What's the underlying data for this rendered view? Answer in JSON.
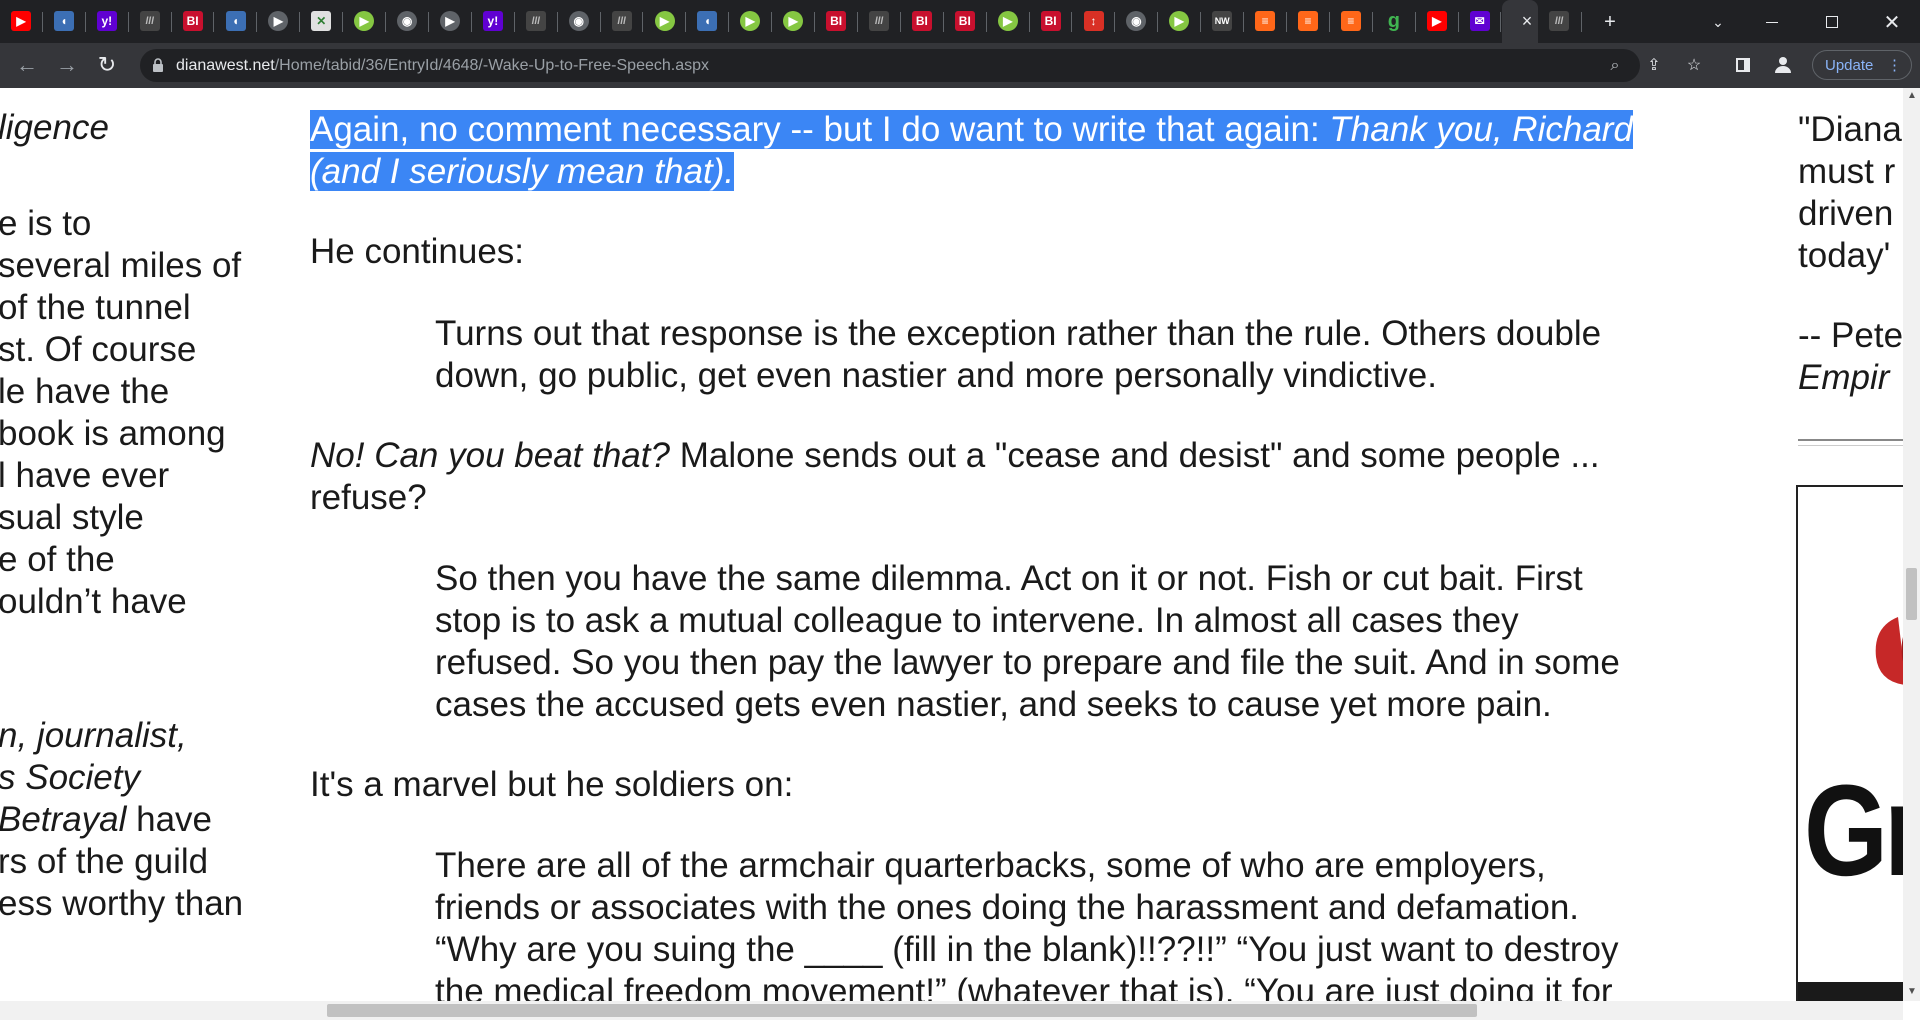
{
  "browser": {
    "tabs": [
      {
        "icon": "youtube-icon",
        "color": "#ff0000",
        "glyph": "▶"
      },
      {
        "icon": "shield-icon",
        "color": "#3c6fb4",
        "glyph": "◖"
      },
      {
        "icon": "yahoo-icon",
        "color": "#6001d2",
        "glyph": "y!"
      },
      {
        "icon": "ltl-icon",
        "color": "#444444",
        "glyph": "lll"
      },
      {
        "icon": "bi-icon",
        "color": "#c8102e",
        "glyph": "BI"
      },
      {
        "icon": "shield-icon",
        "color": "#3c6fb4",
        "glyph": "◖"
      },
      {
        "icon": "flag-icon",
        "color": "#5f6368",
        "glyph": "▶"
      },
      {
        "icon": "doc-icon",
        "color": "#e0e0e0",
        "glyph": "✕"
      },
      {
        "icon": "rumble-icon",
        "color": "#85c742",
        "glyph": "▶"
      },
      {
        "icon": "globe-icon",
        "color": "#5f6368",
        "glyph": "◉"
      },
      {
        "icon": "flag-icon",
        "color": "#5f6368",
        "glyph": "▶"
      },
      {
        "icon": "yahoo-icon",
        "color": "#6001d2",
        "glyph": "y!"
      },
      {
        "icon": "ltl-icon",
        "color": "#444444",
        "glyph": "lll"
      },
      {
        "icon": "globe-icon",
        "color": "#5f6368",
        "glyph": "◉"
      },
      {
        "icon": "ltl-icon",
        "color": "#444444",
        "glyph": "lll"
      },
      {
        "icon": "rumble-icon",
        "color": "#85c742",
        "glyph": "▶"
      },
      {
        "icon": "shield-icon",
        "color": "#3c6fb4",
        "glyph": "◖"
      },
      {
        "icon": "rumble-icon",
        "color": "#85c742",
        "glyph": "▶"
      },
      {
        "icon": "rumble-icon",
        "color": "#85c742",
        "glyph": "▶"
      },
      {
        "icon": "bi-icon",
        "color": "#c8102e",
        "glyph": "BI"
      },
      {
        "icon": "ltl-icon",
        "color": "#444444",
        "glyph": "lll"
      },
      {
        "icon": "bi-icon",
        "color": "#c8102e",
        "glyph": "BI"
      },
      {
        "icon": "bi-icon",
        "color": "#c8102e",
        "glyph": "BI"
      },
      {
        "icon": "rumble-icon",
        "color": "#85c742",
        "glyph": "▶"
      },
      {
        "icon": "bi-icon",
        "color": "#c8102e",
        "glyph": "BI"
      },
      {
        "icon": "pin-icon",
        "color": "#d93025",
        "glyph": "↕"
      },
      {
        "icon": "globe-icon",
        "color": "#5f6368",
        "glyph": "◉"
      },
      {
        "icon": "rumble-icon",
        "color": "#85c742",
        "glyph": "▶"
      },
      {
        "icon": "news-icon",
        "color": "#444444",
        "glyph": "NW"
      },
      {
        "icon": "bookmark-icon",
        "color": "#ff6719",
        "glyph": "≡"
      },
      {
        "icon": "bookmark-icon",
        "color": "#ff6719",
        "glyph": "≡"
      },
      {
        "icon": "bookmark-icon",
        "color": "#ff6719",
        "glyph": "≡"
      },
      {
        "icon": "g-icon",
        "color": "#40b551",
        "glyph": "g"
      },
      {
        "icon": "youtube-icon",
        "color": "#ff0000",
        "glyph": "▶"
      },
      {
        "icon": "mail-icon",
        "color": "#6001d2",
        "glyph": "✉"
      }
    ],
    "active_tab_close": "×",
    "last_tab_icon": "ltl-icon",
    "new_tab": "+",
    "address": {
      "host": "dianawest.net",
      "path": "/Home/tabid/36/EntryId/4648/-Wake-Up-to-Free-Speech.aspx"
    },
    "update_label": "Update"
  },
  "article": {
    "para1_line1_plain": "Again, no comment necessary -- but I do want to write that again: ",
    "para1_line1_italic": "Thank you, Richard",
    "para1_line2_italic": "(and I seriously mean that).",
    "para2": "He continues:",
    "quote1_line1": "Turns out that response is the exception rather than the rule. Others double",
    "quote1_line2": "down, go public, get even nastier and more personally vindictive.",
    "para3_italic": "No! Can you beat that?",
    "para3_plain": " Malone sends out a \"cease and desist\" and some people ...",
    "para3_line2": "refuse?",
    "quote2_line1": "So then you have the same dilemma. Act on it or not. Fish or cut bait. First",
    "quote2_line2": "stop is to ask a mutual colleague to intervene. In almost all cases they",
    "quote2_line3": "refused. So you then pay the lawyer to prepare and file the suit. And in some",
    "quote2_line4": "cases the accused gets even nastier, and seeks to cause yet more pain.",
    "para4": "It's a marvel but he soldiers on:",
    "quote3_line1": "There are all of the armchair quarterbacks, some of who are employers,",
    "quote3_line2": "friends or associates with the ones doing the harassment and defamation.",
    "quote3_line3": "“Why are you suing the ____ (fill in the blank)!!??!!” “You just want to destroy",
    "quote3_line4": "the medical freedom movement!” (whatever that is). “You are just doing it for"
  },
  "left_column": {
    "lines": [
      {
        "text": "ligence",
        "italic": true
      },
      {
        "text": "e is to",
        "italic": false
      },
      {
        "text": "several miles of",
        "italic": false
      },
      {
        "text": "of the tunnel",
        "italic": false
      },
      {
        "text": "st. Of course",
        "italic": false
      },
      {
        "text": "le have the",
        "italic": false
      },
      {
        "text": " book is among",
        "italic": false
      },
      {
        "text": "l have ever",
        "italic": false
      },
      {
        "text": "sual style",
        "italic": false
      },
      {
        "text": "e of the",
        "italic": false
      },
      {
        "text": "ouldn’t have",
        "italic": false
      },
      {
        "text": "n, journalist,",
        "italic": true
      },
      {
        "text": "s Society",
        "italic": true
      },
      {
        "text": "rs of the guild",
        "italic": false
      },
      {
        "text": "ess worthy than",
        "italic": false
      }
    ],
    "betrayal_italic": "Betrayal",
    "betrayal_rest": " have"
  },
  "right_column": {
    "lines": [
      "\"Diana",
      "must r",
      "driven",
      "today'",
      "-- Pete"
    ],
    "italic_line": "Empir",
    "image_letters": "Gr"
  }
}
